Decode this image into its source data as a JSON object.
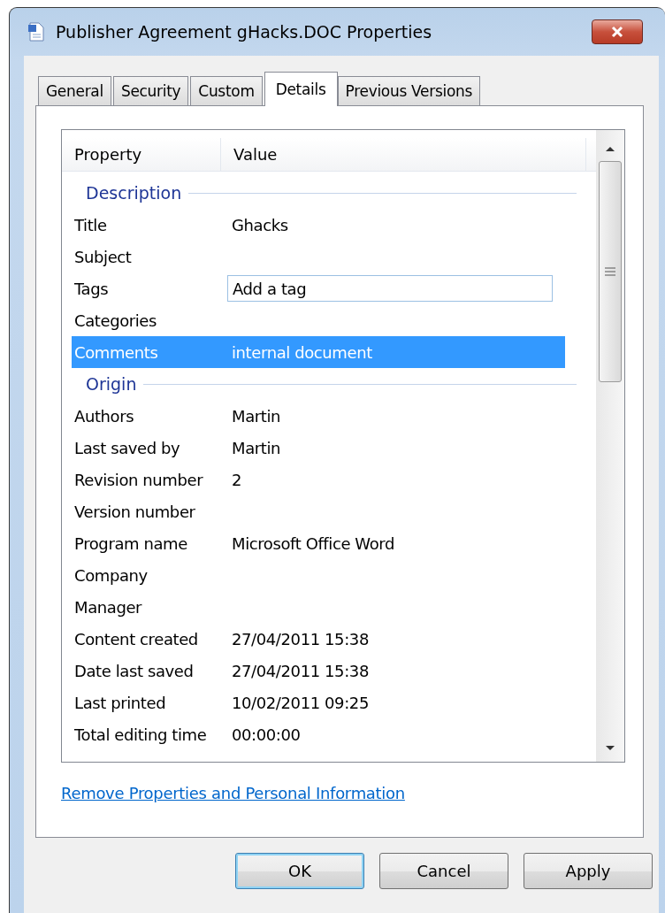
{
  "window": {
    "title": "Publisher Agreement gHacks.DOC Properties"
  },
  "tabs": [
    {
      "label": "General",
      "selected": false
    },
    {
      "label": "Security",
      "selected": false
    },
    {
      "label": "Custom",
      "selected": false
    },
    {
      "label": "Details",
      "selected": true
    },
    {
      "label": "Previous Versions",
      "selected": false
    }
  ],
  "table": {
    "columns": [
      "Property",
      "Value"
    ],
    "rows": [
      {
        "kind": "group",
        "label": "Description"
      },
      {
        "kind": "property",
        "name": "Title",
        "value": "Ghacks",
        "selected": false
      },
      {
        "kind": "property",
        "name": "Subject",
        "selected": false
      },
      {
        "kind": "field",
        "name": "Tags",
        "placeholder": "Add a tag",
        "selected": false
      },
      {
        "kind": "property",
        "name": "Categories",
        "selected": false
      },
      {
        "kind": "property",
        "name": "Comments",
        "value": "internal document",
        "selected": true
      },
      {
        "kind": "group",
        "label": "Origin"
      },
      {
        "kind": "property",
        "name": "Authors",
        "value": "Martin",
        "selected": false
      },
      {
        "kind": "property",
        "name": "Last saved by",
        "value": "Martin",
        "selected": false
      },
      {
        "kind": "property",
        "name": "Revision number",
        "value": "2",
        "selected": false
      },
      {
        "kind": "property",
        "name": "Version number",
        "selected": false
      },
      {
        "kind": "property",
        "name": "Program name",
        "value": "Microsoft Office Word",
        "selected": false
      },
      {
        "kind": "property",
        "name": "Company",
        "selected": false
      },
      {
        "kind": "property",
        "name": "Manager",
        "selected": false
      },
      {
        "kind": "property",
        "name": "Content created",
        "value": "27/04/2011 15:38",
        "selected": false
      },
      {
        "kind": "property",
        "name": "Date last saved",
        "value": "27/04/2011 15:38",
        "selected": false
      },
      {
        "kind": "property",
        "name": "Last printed",
        "value": "10/02/2011 09:25",
        "selected": false
      },
      {
        "kind": "property",
        "name": "Total editing time",
        "value": "00:00:00",
        "selected": false
      }
    ]
  },
  "link": "Remove Properties and Personal Information",
  "buttons": [
    {
      "label": "OK",
      "default": true
    },
    {
      "label": "Cancel",
      "default": false
    },
    {
      "label": "Apply",
      "default": false
    }
  ]
}
